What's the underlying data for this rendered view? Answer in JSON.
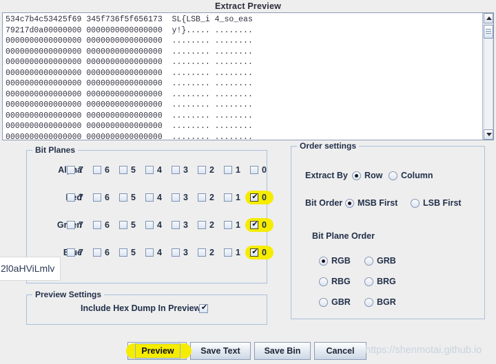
{
  "window": {
    "title": "Extract Preview"
  },
  "preview": {
    "hex_lines": [
      "534c7b4c53425f69 345f736f5f656173  SL{LSB_i 4_so_eas",
      "79217d0a00000000 0000000000000000  y!}..... ........",
      "0000000000000000 0000000000000000  ........ ........",
      "0000000000000000 0000000000000000  ........ ........",
      "0000000000000000 0000000000000000  ........ ........",
      "0000000000000000 0000000000000000  ........ ........",
      "0000000000000000 0000000000000000  ........ ........",
      "0000000000000000 0000000000000000  ........ ........",
      "0000000000000000 0000000000000000  ........ ........",
      "0000000000000000 0000000000000000  ........ ........",
      "0000000000000000 0000000000000000  ........ ........",
      "0000000000000000 0000000000000000  ........ ........"
    ],
    "scrollbar": {
      "up_arrow": "scroll-up-arrow",
      "down_arrow": "scroll-down-arrow"
    }
  },
  "bit_planes": {
    "title": "Bit Planes",
    "bit_labels": [
      "7",
      "6",
      "5",
      "4",
      "3",
      "2",
      "1",
      "0"
    ],
    "rows": [
      {
        "channel": "Alpha",
        "checked": [
          false,
          false,
          false,
          false,
          false,
          false,
          false,
          false
        ],
        "highlighted": [
          false,
          false,
          false,
          false,
          false,
          false,
          false,
          false
        ]
      },
      {
        "channel": "Red",
        "checked": [
          false,
          false,
          false,
          false,
          false,
          false,
          false,
          true
        ],
        "highlighted": [
          false,
          false,
          false,
          false,
          false,
          false,
          false,
          true
        ]
      },
      {
        "channel": "Green",
        "checked": [
          false,
          false,
          false,
          false,
          false,
          false,
          false,
          true
        ],
        "highlighted": [
          false,
          false,
          false,
          false,
          false,
          false,
          false,
          true
        ]
      },
      {
        "channel": "Blue",
        "checked": [
          false,
          false,
          false,
          false,
          false,
          false,
          false,
          true
        ],
        "highlighted": [
          false,
          false,
          false,
          false,
          false,
          false,
          false,
          true
        ]
      }
    ]
  },
  "order_settings": {
    "title": "Order settings",
    "extract_by": {
      "label": "Extract By",
      "options": [
        "Row",
        "Column"
      ],
      "selected": "Row"
    },
    "bit_order": {
      "label": "Bit Order",
      "options": [
        "MSB First",
        "LSB First"
      ],
      "selected": "MSB First"
    },
    "bit_plane_order": {
      "label": "Bit Plane Order",
      "options": [
        "RGB",
        "GRB",
        "RBG",
        "BRG",
        "GBR",
        "BGR"
      ],
      "selected": "RGB"
    }
  },
  "preview_settings": {
    "title": "Preview Settings",
    "include_hex_dump_label": "Include Hex Dump In Preview",
    "include_hex_dump_checked": true
  },
  "buttons": {
    "preview": "Preview",
    "save_text": "Save Text",
    "save_bin": "Save Bin",
    "cancel": "Cancel"
  },
  "overlay_chip": {
    "text": "2l0aHViLmlv"
  },
  "watermark": {
    "text": "https://shenmotai.github.io"
  },
  "colors": {
    "highlight": "#f6ec00",
    "background": "#eeeeee",
    "group_border": "#a9c0dd",
    "text": "#22304a"
  }
}
